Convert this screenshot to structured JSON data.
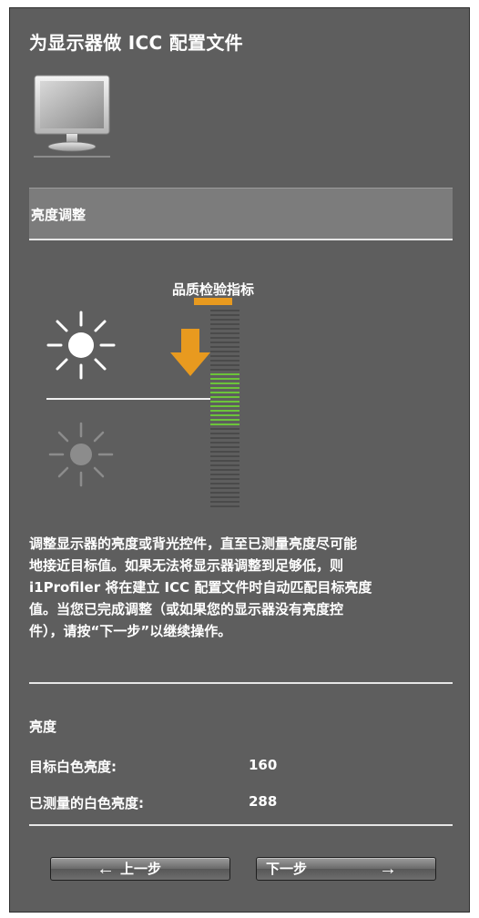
{
  "window": {
    "title": "为显示器做 ICC 配置文件"
  },
  "section": {
    "title": "亮度调整"
  },
  "quality_indicator": {
    "label": "品质检验指标"
  },
  "instructions": {
    "lines": [
      "调整显示器的亮度或背光控件，直至已测量亮度尽可能",
      "地接近目标值。如果无法将显示器调整到足够低，则",
      "i1Profiler 将在建立 ICC 配置文件时自动匹配目标亮度",
      "值。当您已完成调整（或如果您的显示器没有亮度控",
      "件），请按“下一步”以继续操作。"
    ]
  },
  "brightness": {
    "title": "亮度",
    "target_label": "目标白色亮度:",
    "target_value": "160",
    "measured_label": "已测量的白色亮度:",
    "measured_value": "288"
  },
  "buttons": {
    "prev_arrow": "←",
    "prev_label": "上一步",
    "next_label": "下一步",
    "next_arrow": "→"
  },
  "icons": {
    "monitor": "monitor-icon",
    "sun_bright": "sun-bright-icon",
    "sun_dim": "sun-dim-icon",
    "arrow": "down-arrow-icon"
  },
  "colors": {
    "panel_bg": "#5e5e5e",
    "header_bg": "#7c7c7c",
    "accent_orange": "#e89a1f",
    "meter_green": "#6cc43a",
    "meter_gray": "#4a4a4a"
  }
}
